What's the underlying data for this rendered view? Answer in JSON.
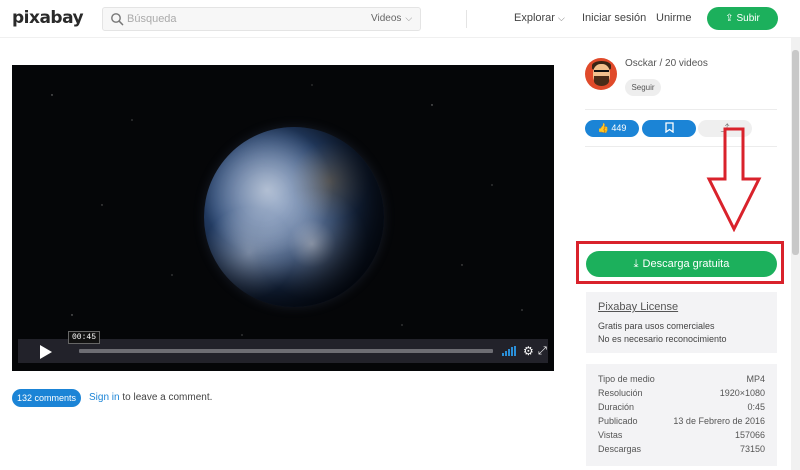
{
  "header": {
    "logo": "pixabay",
    "search_placeholder": "Búsqueda",
    "search_type": "Videos",
    "nav_explore": "Explorar",
    "nav_login": "Iniciar sesión",
    "nav_join": "Unirme",
    "upload_label": "Subir"
  },
  "video": {
    "current_time": "00:45",
    "progress": 0.0
  },
  "comments": {
    "count_label": "132 comments",
    "signin_link": "Sign in",
    "signin_rest": " to leave a comment."
  },
  "author": {
    "line": "Osckar / 20 videos",
    "follow_label": "Seguir"
  },
  "actions": {
    "likes": "449"
  },
  "download": {
    "label": "Descarga gratuita"
  },
  "license": {
    "title": "Pixabay License",
    "line1": "Gratis para usos comerciales",
    "line2": "No es necesario reconocimiento"
  },
  "details": [
    {
      "key": "Tipo de medio",
      "value": "MP4"
    },
    {
      "key": "Resolución",
      "value": "1920×1080"
    },
    {
      "key": "Duración",
      "value": "0:45"
    },
    {
      "key": "Publicado",
      "value": "13 de Febrero de 2016"
    },
    {
      "key": "Vistas",
      "value": "157066"
    },
    {
      "key": "Descargas",
      "value": "73150"
    }
  ],
  "colors": {
    "brand_green": "#1cb05c",
    "accent_blue": "#1b84d6",
    "annotation_red": "#d9222b"
  }
}
